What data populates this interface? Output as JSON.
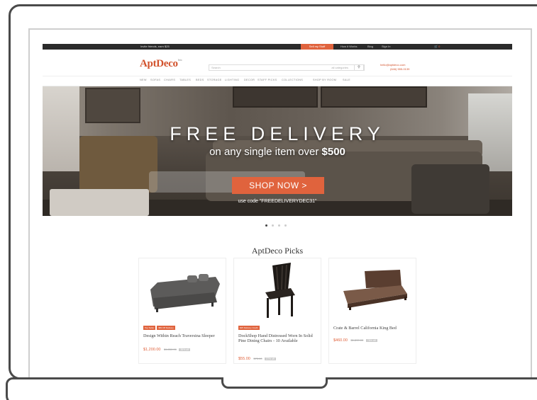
{
  "topbar": {
    "promo": "Invite friends, earn $25",
    "sell": "Sell my Stuff",
    "links": [
      "How it Works",
      "Blog",
      "Sign In"
    ],
    "cart": "0"
  },
  "header": {
    "logo": "AptDeco",
    "logo_sup": "beta",
    "search_placeholder": "Search",
    "search_category": "all categories",
    "contact_email": "hello@aptdeco.com",
    "contact_phone": "(646) 555-0139"
  },
  "nav": [
    "New",
    "Sofas",
    "Chairs",
    "Tables",
    "Beds",
    "Storage",
    "Lighting",
    "Decor",
    "Staff Picks",
    "Collections",
    "Shop by Room",
    "Sale"
  ],
  "hero": {
    "title": "FREE DELIVERY",
    "subtitle_prefix": "on any single item over ",
    "subtitle_amount": "$500",
    "button": "SHOP NOW >",
    "code": "use code \"FREEDELIVERYDEC31\""
  },
  "carousel": {
    "count": 4,
    "active": 0
  },
  "picks": {
    "title": "AptDeco Picks",
    "items": [
      {
        "name": "Design Within Reach Traversina Sleeper",
        "price": "$1,200.00",
        "old_price": "$1,850.00",
        "pct": "35% off",
        "badges": [
          "Top Seller",
          "$50 Off Delivery"
        ]
      },
      {
        "name": "DockShop Hand Distressed Worn In Solid Pine Dining Chairs - 10 Available",
        "price": "$55.00",
        "old_price": "$75.00",
        "pct": "27% off",
        "badges": [
          "$25 Delivery Credit"
        ]
      },
      {
        "name": "Crate & Barrel California King Bed",
        "price": "$460.00",
        "old_price": "$1,899.00",
        "pct": "76% off",
        "badges": []
      }
    ]
  }
}
